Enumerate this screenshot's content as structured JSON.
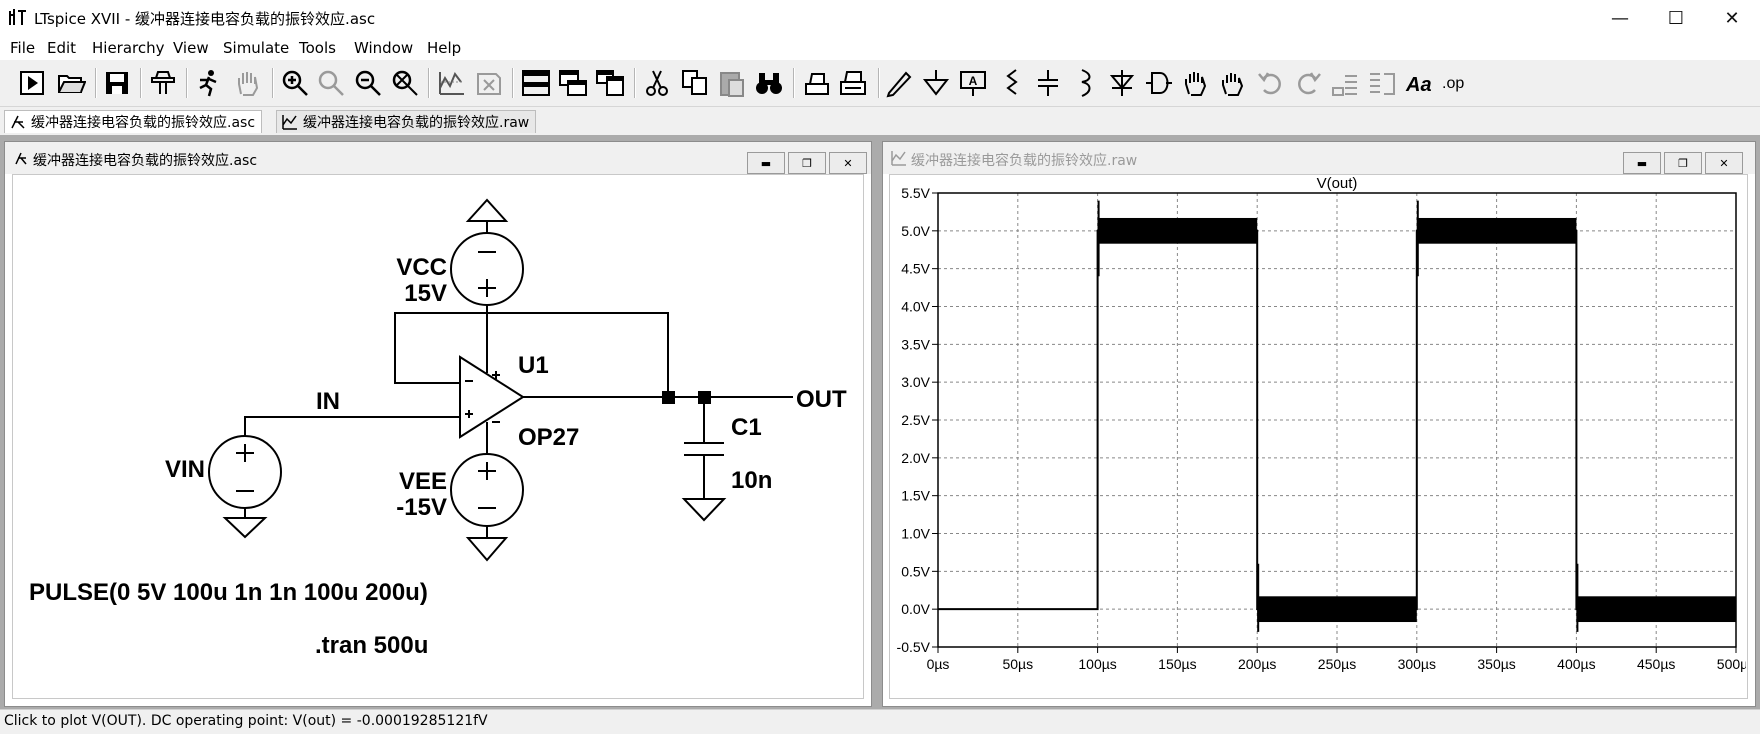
{
  "window": {
    "title": "LTspice XVII - 缓冲器连接电容负载的振铃效应.asc",
    "minimize": "—",
    "maximize": "☐",
    "close": "✕"
  },
  "menu": [
    "File",
    "Edit",
    "Hierarchy",
    "View",
    "Simulate",
    "Tools",
    "Window",
    "Help"
  ],
  "toolbar_icons": [
    "run-icon",
    "open-icon",
    "save-icon",
    "control-panel-icon",
    "halt-icon",
    "pan-icon",
    "zoom-in-icon",
    "zoom-area-icon",
    "zoom-out-icon",
    "zoom-fit-icon",
    "autorange-icon",
    "mark-icon",
    "tile-horizontal-icon",
    "cascade-icon",
    "tile-vertical-icon",
    "cut-icon",
    "copy-icon",
    "paste-icon",
    "find-icon",
    "print-setup-icon",
    "print-icon",
    "wire-icon",
    "ground-icon",
    "label-icon",
    "resistor-icon",
    "capacitor-icon",
    "inductor-icon",
    "diode-icon",
    "component-icon",
    "move-icon",
    "drag-icon",
    "undo-icon",
    "redo-icon",
    "rotate-icon",
    "mirror-icon",
    "text-icon",
    "spice-directive-icon"
  ],
  "tabs": [
    {
      "label": "缓冲器连接电容负载的振铃效应.asc"
    },
    {
      "label": "缓冲器连接电容负载的振铃效应.raw"
    }
  ],
  "schematic_window": {
    "title": "缓冲器连接电容负载的振铃效应.asc",
    "labels": {
      "vcc": "VCC",
      "vcc_val": "15V",
      "vee": "VEE",
      "vee_val": "-15V",
      "vin": "VIN",
      "in": "IN",
      "out": "OUT",
      "u1": "U1",
      "op27": "OP27",
      "c1": "C1",
      "c1_val": "10n",
      "pulse": "PULSE(0 5V 100u 1n 1n 100u 200u)",
      "tran": ".tran 500u"
    }
  },
  "waveform_window": {
    "title": "缓冲器连接电容负载的振铃效应.raw"
  },
  "chart_data": {
    "type": "line",
    "title": "V(out)",
    "xlabel": "",
    "ylabel": "",
    "xlim": [
      0,
      500
    ],
    "ylim": [
      -0.5,
      5.5
    ],
    "grid": true,
    "x_tick_labels": [
      "0µs",
      "50µs",
      "100µs",
      "150µs",
      "200µs",
      "250µs",
      "300µs",
      "350µs",
      "400µs",
      "450µs",
      "500µs"
    ],
    "y_tick_labels": [
      "5.5V",
      "5.0V",
      "4.5V",
      "4.0V",
      "3.5V",
      "3.0V",
      "2.5V",
      "2.0V",
      "1.5V",
      "1.0V",
      "0.5V",
      "0.0V",
      "-0.5V"
    ],
    "series": [
      {
        "name": "V(out)",
        "color": "#000000",
        "x": [
          0,
          100,
          100,
          200,
          200,
          300,
          300,
          400,
          400,
          500
        ],
        "y": [
          0.0,
          0.0,
          5.0,
          5.0,
          0.0,
          0.0,
          5.0,
          5.0,
          0.0,
          0.0
        ],
        "ringing_band": {
          "high": [
            4.83,
            5.17
          ],
          "low": [
            -0.17,
            0.17
          ]
        }
      }
    ]
  },
  "status": "Click to plot V(OUT).  DC operating point: V(out) = -0.00019285121fV"
}
